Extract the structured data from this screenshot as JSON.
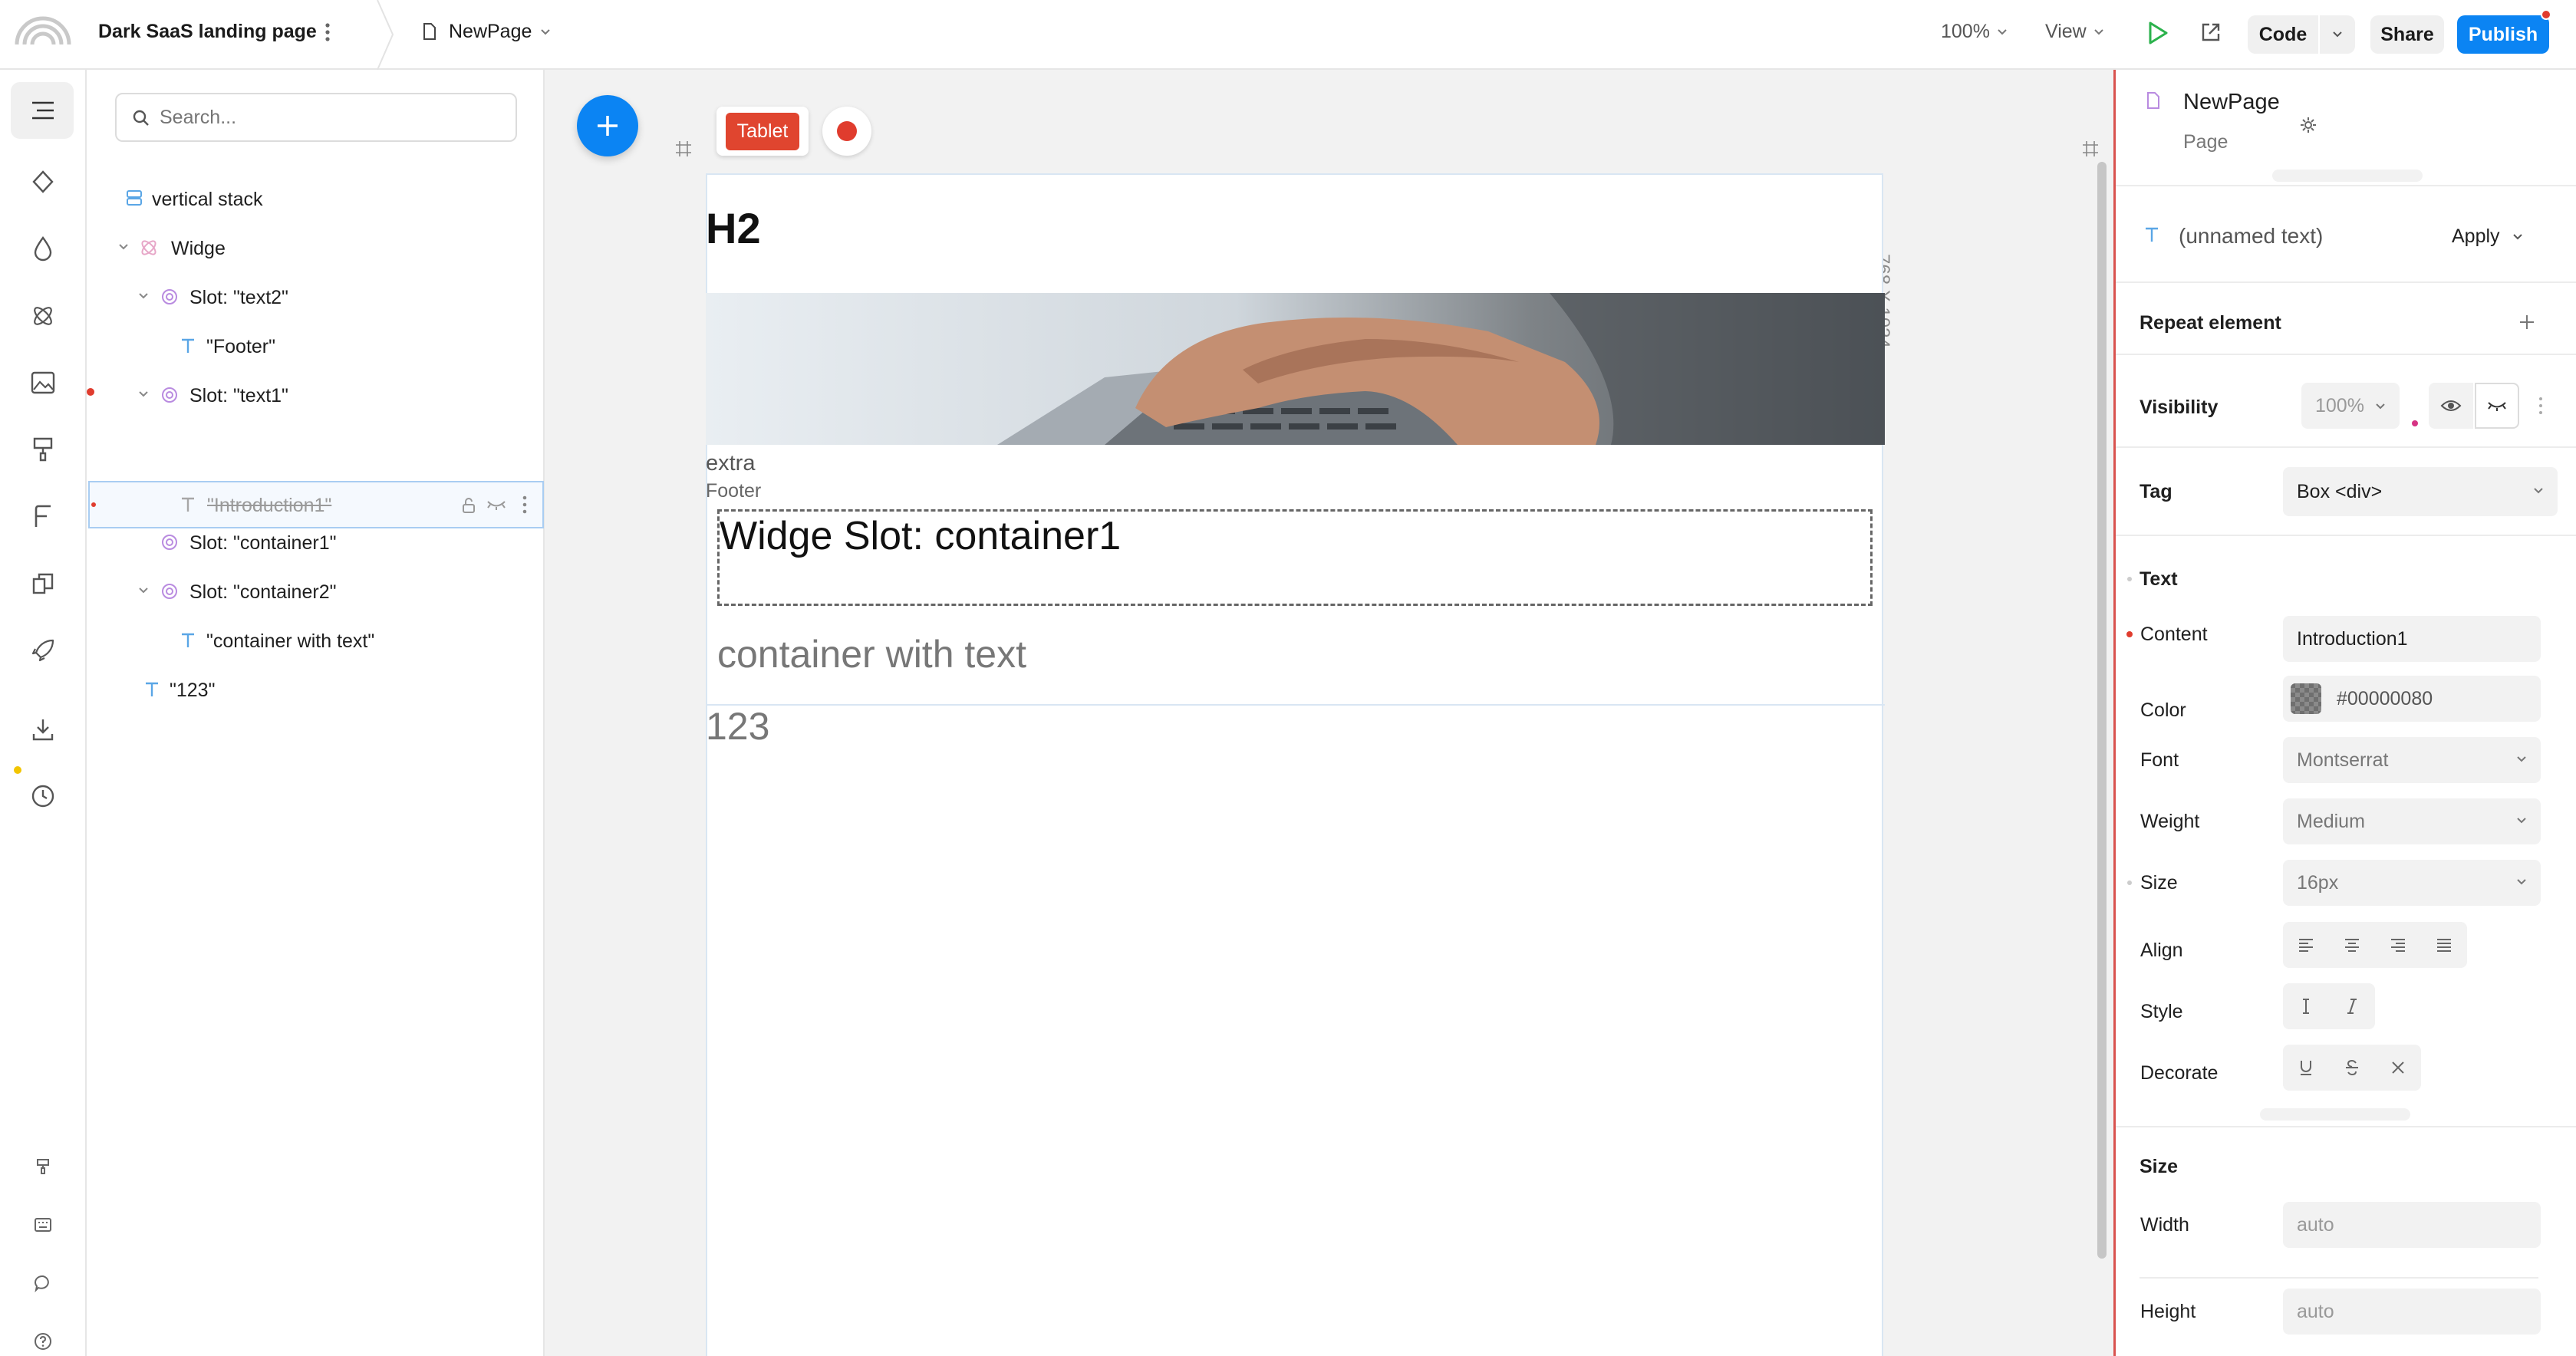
{
  "topbar": {
    "project_name": "Dark SaaS landing page",
    "page_name": "NewPage",
    "zoom": "100%",
    "view_label": "View",
    "code_label": "Code",
    "share_label": "Share",
    "publish_label": "Publish"
  },
  "layers": {
    "search_placeholder": "Search...",
    "items": [
      {
        "label": "vertical stack"
      },
      {
        "label": "Widge"
      },
      {
        "label": "Slot: \"text2\""
      },
      {
        "label": "\"Footer\""
      },
      {
        "label": "Slot: \"text1\""
      },
      {
        "label": "\"Introduction1\""
      },
      {
        "label": "Slot: \"container1\""
      },
      {
        "label": "Slot: \"container2\""
      },
      {
        "label": "\"container with text\""
      },
      {
        "label": "\"123\""
      }
    ]
  },
  "canvas": {
    "device_label": "Tablet",
    "dimensions": "768 X 1024",
    "heading": "H2",
    "extra": "extra",
    "footer": "Footer",
    "slot_title": "Widge Slot: container1",
    "container_text": "container with text",
    "number_text": "123"
  },
  "props": {
    "page_title": "NewPage",
    "page_subtitle": "Page",
    "element_name": "(unnamed text)",
    "apply_label": "Apply",
    "repeat_label": "Repeat element",
    "visibility_label": "Visibility",
    "visibility_value": "100%",
    "tag_label": "Tag",
    "tag_value": "Box <div>",
    "text_section": "Text",
    "content_label": "Content",
    "content_value": "Introduction1",
    "color_label": "Color",
    "color_value": "#00000080",
    "font_label": "Font",
    "font_value": "Montserrat",
    "weight_label": "Weight",
    "weight_value": "Medium",
    "size_label": "Size",
    "size_value": "16px",
    "align_label": "Align",
    "style_label": "Style",
    "decorate_label": "Decorate",
    "size_section": "Size",
    "width_label": "Width",
    "width_value": "auto",
    "height_label": "Height",
    "height_value": "auto"
  },
  "colors": {
    "accent": "#0b84f3",
    "record": "#e03c2e",
    "tablet_badge": "#e0452f",
    "slot_icon": "#b98be0",
    "text_icon": "#5aa6e6",
    "play": "#2bb24c"
  }
}
